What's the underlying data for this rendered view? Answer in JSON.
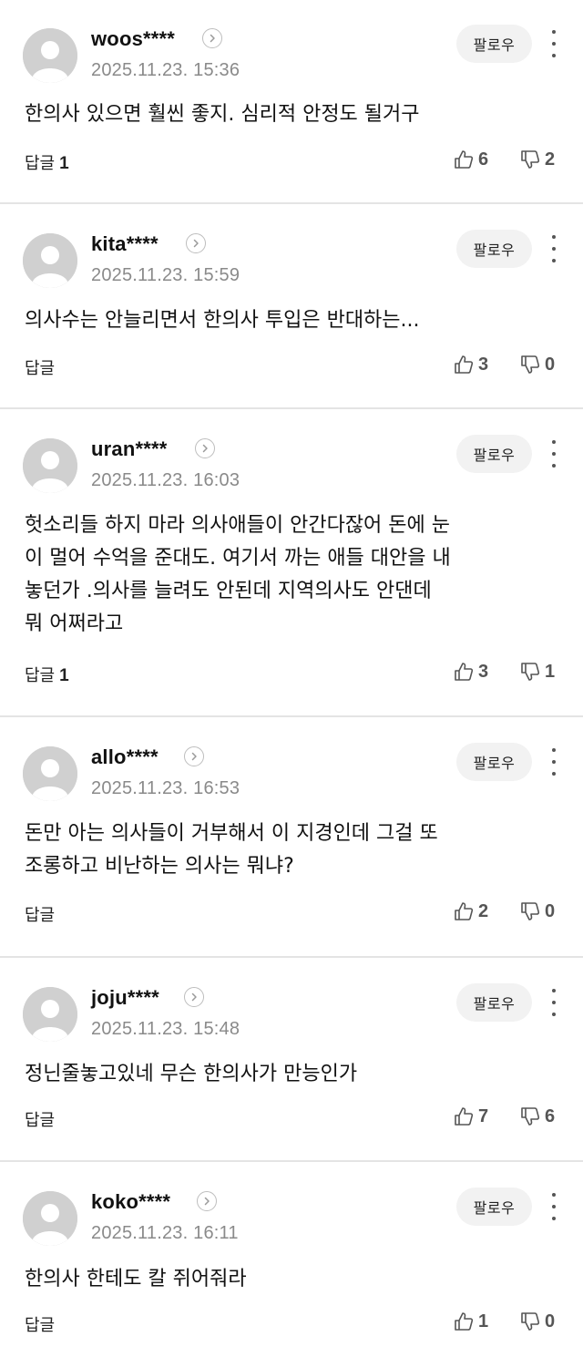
{
  "follow_label": "팔로우",
  "reply_label": "답글",
  "comments": [
    {
      "username": "woos****",
      "date": "2025.11.23. 15:36",
      "text": "한의사 있으면 훨씬 좋지. 심리적 안정도 될거구",
      "reply_count": "1",
      "likes": "6",
      "dislikes": "2"
    },
    {
      "username": "kita****",
      "date": "2025.11.23. 15:59",
      "text": "의사수는 안늘리면서 한의사 투입은 반대하는...",
      "reply_count": "",
      "likes": "3",
      "dislikes": "0"
    },
    {
      "username": "uran****",
      "date": "2025.11.23. 16:03",
      "text": "헛소리들 하지 마라 의사애들이 안간다잖어 돈에 눈\n이 멀어 수억을 준대도. 여기서 까는 애들 대안을 내\n놓던가 .의사를 늘려도 안된데 지역의사도 안댄데\n뭐 어쩌라고",
      "reply_count": "1",
      "likes": "3",
      "dislikes": "1"
    },
    {
      "username": "allo****",
      "date": "2025.11.23. 16:53",
      "text": "돈만 아는 의사들이 거부해서 이 지경인데 그걸 또\n조롱하고 비난하는 의사는 뭐냐?",
      "reply_count": "",
      "likes": "2",
      "dislikes": "0"
    },
    {
      "username": "joju****",
      "date": "2025.11.23. 15:48",
      "text": "정닌줄놓고있네 무슨 한의사가 만능인가",
      "reply_count": "",
      "likes": "7",
      "dislikes": "6"
    },
    {
      "username": "koko****",
      "date": "2025.11.23. 16:11",
      "text": "한의사 한테도 칼 쥐어줘라",
      "reply_count": "",
      "likes": "1",
      "dislikes": "0"
    }
  ],
  "icons": {
    "avatar": "default-user-avatar",
    "profile": "chevron-right-circle-icon",
    "more": "vertical-ellipsis-icon",
    "like": "thumbs-up-icon",
    "dislike": "thumbs-down-icon"
  },
  "colors": {
    "avatar_bg": "#d0d0d0",
    "follow_bg": "#f2f2f2",
    "date": "#8a8a8a",
    "divider": "#e4e4e4"
  }
}
